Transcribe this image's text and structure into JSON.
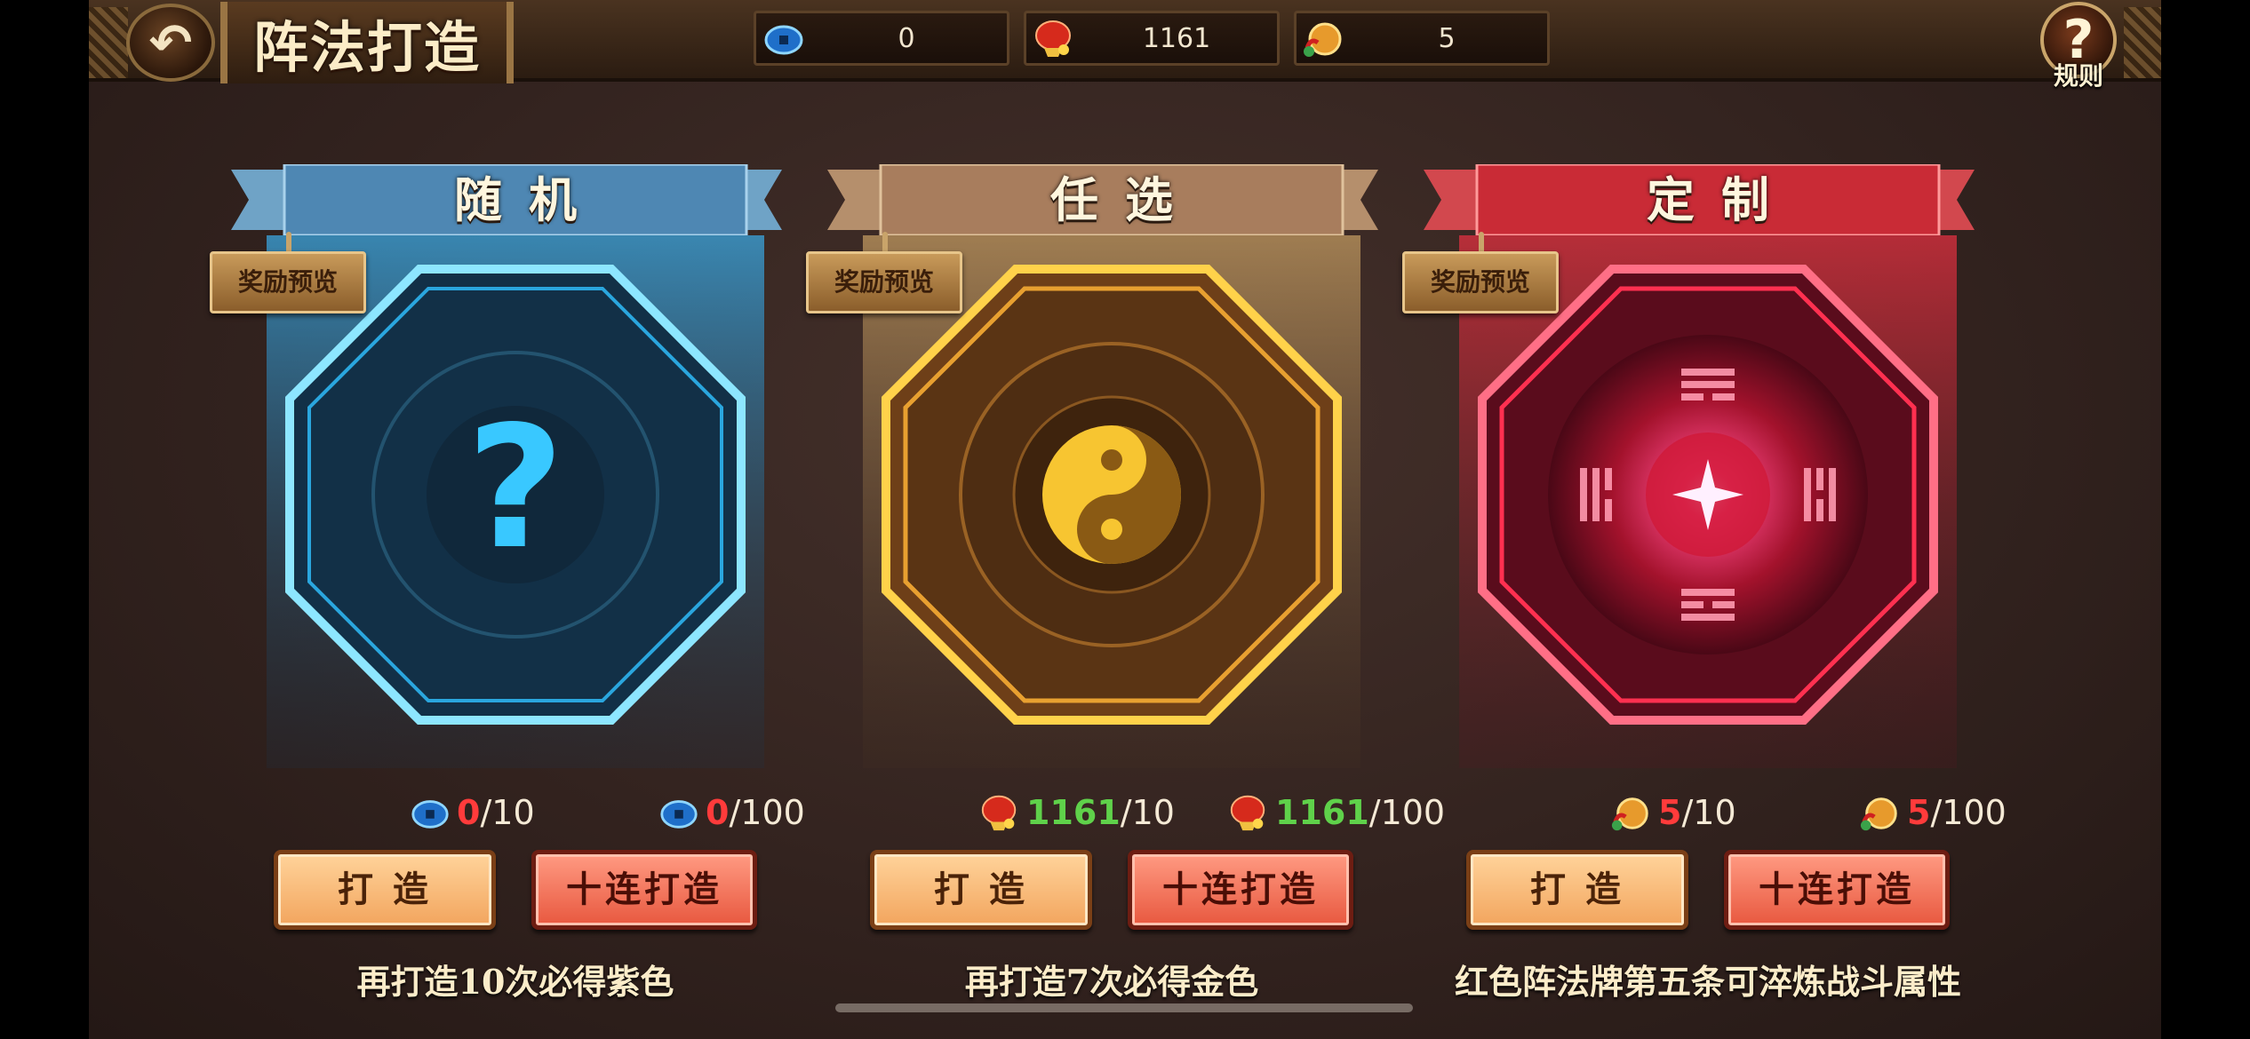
{
  "header": {
    "title": "阵法打造",
    "back_icon": "back-arrow-icon",
    "rules_label": "规则",
    "rules_icon": "question-icon"
  },
  "resources": [
    {
      "name": "coin",
      "icon": "blue-coin-icon",
      "value": "0"
    },
    {
      "name": "gourd",
      "icon": "red-gourd-icon",
      "value": "1161"
    },
    {
      "name": "medal",
      "icon": "gold-token-icon",
      "value": "5"
    }
  ],
  "cards": [
    {
      "title": "随机",
      "theme": "#3fb6e6",
      "preview_label": "奖励预览",
      "emblem": "question-mark-emblem",
      "single_cost": {
        "icon": "blue-coin-icon",
        "have": "0",
        "need": "10",
        "have_color": "#ff3b3b"
      },
      "ten_cost": {
        "icon": "blue-coin-icon",
        "have": "0",
        "need": "100",
        "have_color": "#ff3b3b"
      },
      "single_label": "打 造",
      "ten_label": "十连打造",
      "hint": "再打造10次必得紫色"
    },
    {
      "title": "任选",
      "theme": "#e5b43a",
      "preview_label": "奖励预览",
      "emblem": "yin-yang-emblem",
      "single_cost": {
        "icon": "red-gourd-icon",
        "have": "1161",
        "need": "10",
        "have_color": "#5fd14a"
      },
      "ten_cost": {
        "icon": "red-gourd-icon",
        "have": "1161",
        "need": "100",
        "have_color": "#5fd14a"
      },
      "single_label": "打 造",
      "ten_label": "十连打造",
      "hint": "再打造7次必得金色"
    },
    {
      "title": "定制",
      "theme": "#ff3d5e",
      "preview_label": "奖励预览",
      "emblem": "bagua-star-emblem",
      "single_cost": {
        "icon": "gold-token-icon",
        "have": "5",
        "need": "10",
        "have_color": "#ff3b3b"
      },
      "ten_cost": {
        "icon": "gold-token-icon",
        "have": "5",
        "need": "100",
        "have_color": "#ff3b3b"
      },
      "single_label": "打 造",
      "ten_label": "十连打造",
      "hint": "红色阵法牌第五条可淬炼战斗属性"
    }
  ]
}
